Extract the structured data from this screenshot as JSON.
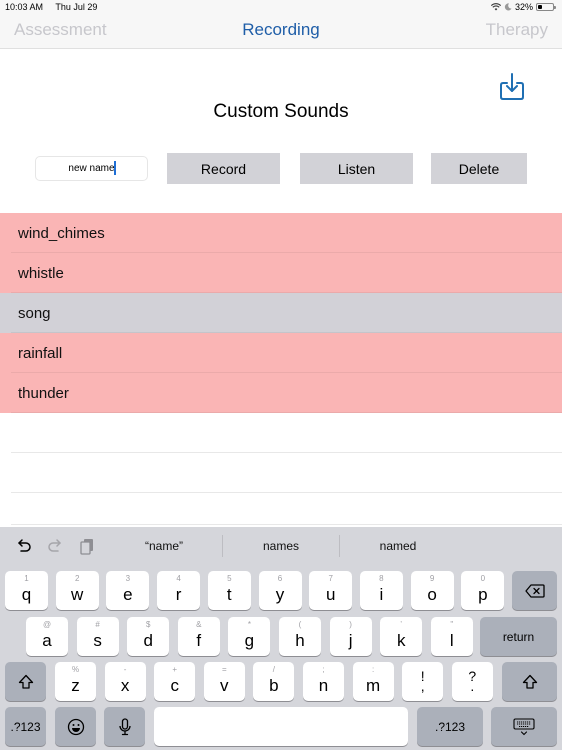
{
  "status_bar": {
    "time": "10:03 AM",
    "date": "Thu Jul 29",
    "battery_percent_label": "32%",
    "battery_level": 0.32,
    "icons": [
      "wifi-icon",
      "moon-icon",
      "battery-icon"
    ]
  },
  "nav": {
    "tabs": [
      {
        "label": "Assessment",
        "active": false
      },
      {
        "label": "Recording",
        "active": true
      },
      {
        "label": "Therapy",
        "active": false
      }
    ],
    "active_color": "#1f5ea8",
    "inactive_color": "#c7c7cc"
  },
  "header": {
    "title": "Custom Sounds",
    "download_icon": "download-tray-icon"
  },
  "controls": {
    "name_input_value": "new name",
    "record_label": "Record",
    "listen_label": "Listen",
    "delete_label": "Delete"
  },
  "sounds": {
    "colors": {
      "pink": "#fab5b5",
      "gray": "#d2d1d7"
    },
    "items": [
      {
        "name": "wind_chimes",
        "color": "pink"
      },
      {
        "name": "whistle",
        "color": "pink"
      },
      {
        "name": "song",
        "color": "gray"
      },
      {
        "name": "rainfall",
        "color": "pink"
      },
      {
        "name": "thunder",
        "color": "pink"
      }
    ]
  },
  "keyboard": {
    "tools": [
      "undo-icon",
      "redo-icon",
      "paste-icon"
    ],
    "suggestions": [
      "“name”",
      "names",
      "named"
    ],
    "row1": [
      {
        "alt": "1",
        "key": "q"
      },
      {
        "alt": "2",
        "key": "w"
      },
      {
        "alt": "3",
        "key": "e"
      },
      {
        "alt": "4",
        "key": "r"
      },
      {
        "alt": "5",
        "key": "t"
      },
      {
        "alt": "6",
        "key": "y"
      },
      {
        "alt": "7",
        "key": "u"
      },
      {
        "alt": "8",
        "key": "i"
      },
      {
        "alt": "9",
        "key": "o"
      },
      {
        "alt": "0",
        "key": "p"
      }
    ],
    "row2": [
      {
        "alt": "@",
        "key": "a"
      },
      {
        "alt": "#",
        "key": "s"
      },
      {
        "alt": "$",
        "key": "d"
      },
      {
        "alt": "&",
        "key": "f"
      },
      {
        "alt": "*",
        "key": "g"
      },
      {
        "alt": "(",
        "key": "h"
      },
      {
        "alt": ")",
        "key": "j"
      },
      {
        "alt": "’",
        "key": "k"
      },
      {
        "alt": "\"",
        "key": "l"
      }
    ],
    "row3": [
      {
        "alt": "%",
        "key": "z"
      },
      {
        "alt": "-",
        "key": "x"
      },
      {
        "alt": "+",
        "key": "c"
      },
      {
        "alt": "=",
        "key": "v"
      },
      {
        "alt": "/",
        "key": "b"
      },
      {
        "alt": ";",
        "key": "n"
      },
      {
        "alt": ":",
        "key": "m"
      },
      {
        "alt": "!",
        "key": ","
      },
      {
        "alt": "?",
        "key": "."
      }
    ],
    "return_label": "return",
    "numbers_label": ".?123"
  }
}
